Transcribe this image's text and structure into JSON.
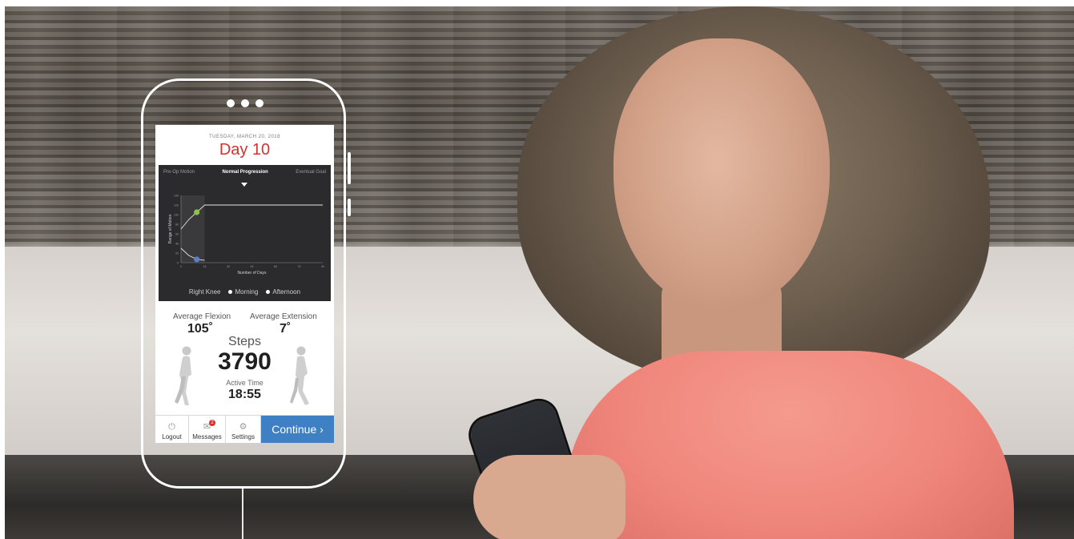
{
  "app": {
    "date": "TUESDAY, MARCH 20, 2018",
    "day": "Day 10"
  },
  "chart": {
    "tabs": [
      "Pre-Op Motion",
      "Normal Progression",
      "Eventual Goal"
    ],
    "active_tab": "Normal Progression",
    "ylabel": "Range of Motion",
    "xlabel": "Number of Days",
    "legend": {
      "knee": "Right Knee",
      "morning": "Morning",
      "afternoon": "Afternoon"
    }
  },
  "chart_data": {
    "type": "line",
    "xlabel": "Number of Days",
    "ylabel": "Range of Motion",
    "x_ticks": [
      "0",
      "15",
      "30",
      "45",
      "60",
      "75",
      "90"
    ],
    "y_ticks": [
      "0",
      "20",
      "40",
      "60",
      "80",
      "100",
      "120",
      "140"
    ],
    "xlim": [
      0,
      90
    ],
    "ylim": [
      0,
      140
    ],
    "series": [
      {
        "name": "Morning",
        "points": [
          [
            0,
            70
          ],
          [
            5,
            90
          ],
          [
            10,
            105
          ],
          [
            15,
            120
          ],
          [
            90,
            120
          ]
        ]
      },
      {
        "name": "Afternoon",
        "points": [
          [
            0,
            30
          ],
          [
            5,
            15
          ],
          [
            10,
            7
          ],
          [
            15,
            5
          ]
        ]
      }
    ],
    "highlight_points": [
      {
        "x": 10,
        "y": 105,
        "color": "#8bc34a"
      },
      {
        "x": 10,
        "y": 7,
        "color": "#5c7fc8"
      }
    ]
  },
  "stats": {
    "flexion_label": "Average Flexion",
    "flexion_value": "105˚",
    "extension_label": "Average Extension",
    "extension_value": "7˚",
    "steps_label": "Steps",
    "steps_value": "3790",
    "active_label": "Active Time",
    "active_value": "18:55"
  },
  "nav": {
    "logout": "Logout",
    "messages": "Messages",
    "messages_badge": "2",
    "settings": "Settings",
    "continue": "Continue ›"
  },
  "icons": {
    "logout": "power-icon",
    "messages": "envelope-icon",
    "settings": "gear-icon"
  },
  "colors": {
    "accent": "#d4322c",
    "button": "#3f7fc3",
    "chart_bg": "#2b2b2d"
  }
}
